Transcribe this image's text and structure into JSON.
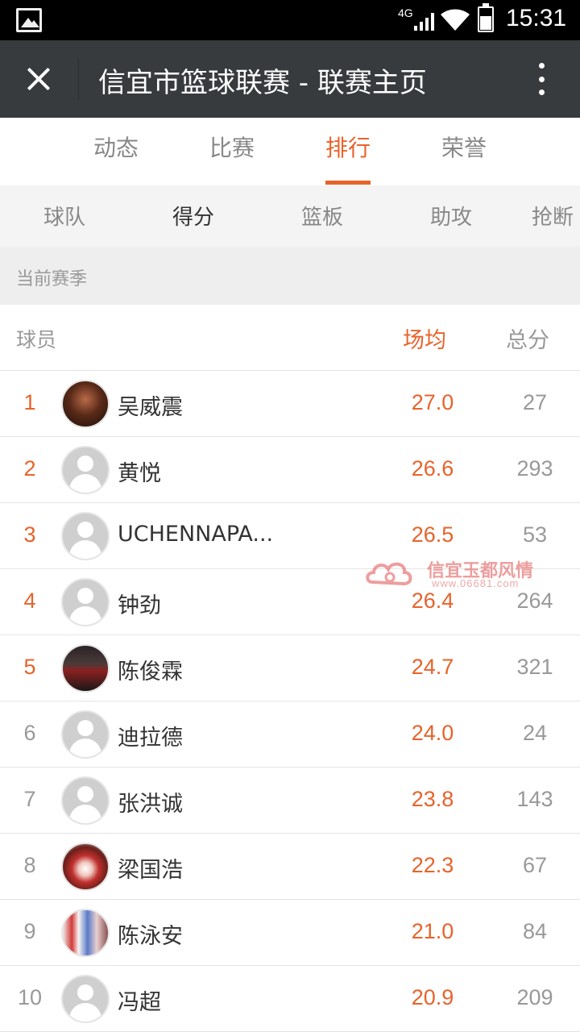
{
  "status_bar": {
    "network": "4G",
    "time": "15:31",
    "battery_level": 0.6
  },
  "title_bar": {
    "title": "信宜市篮球联赛 - 联赛主页"
  },
  "main_tabs": [
    {
      "label": "动态",
      "active": false
    },
    {
      "label": "比赛",
      "active": false
    },
    {
      "label": "排行",
      "active": true
    },
    {
      "label": "荣誉",
      "active": false
    }
  ],
  "sub_tabs": [
    {
      "label": "球队",
      "active": false
    },
    {
      "label": "得分",
      "active": true
    },
    {
      "label": "篮板",
      "active": false
    },
    {
      "label": "助攻",
      "active": false
    },
    {
      "label": "抢断",
      "active": false
    }
  ],
  "season_label": "当前赛季",
  "table_header": {
    "player": "球员",
    "avg": "场均",
    "total": "总分"
  },
  "rows": [
    {
      "rank": "1",
      "name": "吴威震",
      "avg": "27.0",
      "total": "27",
      "avatar": "photo-dark"
    },
    {
      "rank": "2",
      "name": "黄悦",
      "avg": "26.6",
      "total": "293",
      "avatar": "default"
    },
    {
      "rank": "3",
      "name": "UCHENNAPA...",
      "avg": "26.5",
      "total": "53",
      "avatar": "default"
    },
    {
      "rank": "4",
      "name": "钟劲",
      "avg": "26.4",
      "total": "264",
      "avatar": "default"
    },
    {
      "rank": "5",
      "name": "陈俊霖",
      "avg": "24.7",
      "total": "321",
      "avatar": "photo-stage"
    },
    {
      "rank": "6",
      "name": "迪拉德",
      "avg": "24.0",
      "total": "24",
      "avatar": "default"
    },
    {
      "rank": "7",
      "name": "张洪诚",
      "avg": "23.8",
      "total": "143",
      "avatar": "default"
    },
    {
      "rank": "8",
      "name": "梁国浩",
      "avg": "22.3",
      "total": "67",
      "avatar": "photo-rose"
    },
    {
      "rank": "9",
      "name": "陈泳安",
      "avg": "21.0",
      "total": "84",
      "avatar": "photo-group"
    },
    {
      "rank": "10",
      "name": "冯超",
      "avg": "20.9",
      "total": "209",
      "avatar": "default"
    }
  ],
  "watermark": {
    "text": "信宜玉都风情",
    "url": "www.06681.com"
  },
  "colors": {
    "accent": "#e8632a",
    "titlebar": "#383b3e"
  }
}
